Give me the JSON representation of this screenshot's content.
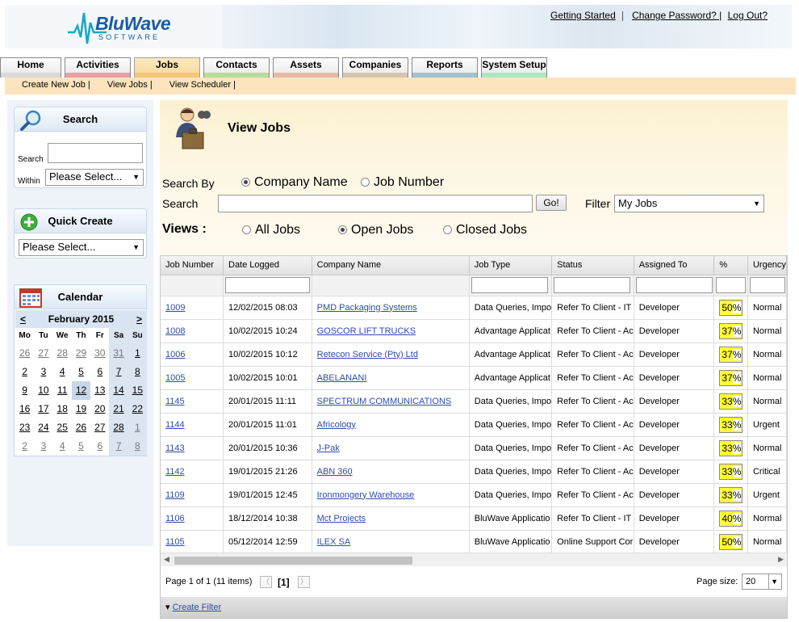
{
  "brand": {
    "logo_main": "BluWave",
    "logo_sub": "SOFTWARE"
  },
  "top_links": {
    "getting_started": "Getting Started",
    "change_password": "Change Password? |",
    "logout": "Log Out?"
  },
  "tabs": [
    {
      "label": "Home",
      "color": "#d9d9d9"
    },
    {
      "label": "Activities",
      "color": "#e8a0a8"
    },
    {
      "label": "Jobs",
      "color": "#f6c77a"
    },
    {
      "label": "Contacts",
      "color": "#b9dc9c"
    },
    {
      "label": "Assets",
      "color": "#e6b9a6"
    },
    {
      "label": "Companies",
      "color": "#d8c5ad"
    },
    {
      "label": "Reports",
      "color": "#9fc2d0"
    },
    {
      "label": "System Setup",
      "color": "#a9e8c2"
    }
  ],
  "subnav": [
    "Create New Job |",
    "View Jobs |",
    "View Scheduler |"
  ],
  "sidebar": {
    "search": {
      "title": "Search",
      "label_search": "Search",
      "label_within": "Within",
      "within_value": "Please Select..."
    },
    "quick_create": {
      "title": "Quick Create",
      "value": "Please Select..."
    },
    "calendar": {
      "title": "Calendar",
      "month": "February 2015",
      "prev": "<",
      "next": ">",
      "dow": [
        "Mo",
        "Tu",
        "We",
        "Th",
        "Fr",
        "Sa",
        "Su"
      ],
      "weeks": [
        [
          "26",
          "27",
          "28",
          "29",
          "30",
          "31",
          "1"
        ],
        [
          "2",
          "3",
          "4",
          "5",
          "6",
          "7",
          "8"
        ],
        [
          "9",
          "10",
          "11",
          "12",
          "13",
          "14",
          "15"
        ],
        [
          "16",
          "17",
          "18",
          "19",
          "20",
          "21",
          "22"
        ],
        [
          "23",
          "24",
          "25",
          "26",
          "27",
          "28",
          "1"
        ],
        [
          "2",
          "3",
          "4",
          "5",
          "6",
          "7",
          "8"
        ]
      ]
    }
  },
  "main": {
    "title": "View Jobs",
    "search_by_label": "Search By",
    "search_by_options": [
      "Company Name",
      "Job Number"
    ],
    "search_label": "Search",
    "go_label": "Go!",
    "filter_label": "Filter",
    "filter_value": "My Jobs",
    "views_label": "Views :",
    "views_options": [
      "All Jobs",
      "Open Jobs",
      "Closed Jobs"
    ]
  },
  "grid": {
    "columns": [
      "Job Number",
      "Date Logged",
      "Company Name",
      "Job Type",
      "Status",
      "Assigned To",
      "%",
      "Urgency"
    ],
    "rows": [
      {
        "job": "1009",
        "date": "12/02/2015 08:03",
        "company": "PMD Packaging Systems",
        "type": "Data Queries, Impo",
        "status": "Refer To Client - IT",
        "assigned": "Developer",
        "pct": "50",
        "urgency": "Normal"
      },
      {
        "job": "1008",
        "date": "10/02/2015 10:24",
        "company": "GOSCOR LIFT TRUCKS",
        "type": "Advantage Applicat",
        "status": "Refer To Client - Ac",
        "assigned": "Developer",
        "pct": "37",
        "urgency": "Normal"
      },
      {
        "job": "1006",
        "date": "10/02/2015 10:12",
        "company": "Retecon Service (Pty) Ltd",
        "type": "Advantage Applicat",
        "status": "Refer To Client - Ac",
        "assigned": "Developer",
        "pct": "37",
        "urgency": "Normal"
      },
      {
        "job": "1005",
        "date": "10/02/2015 10:01",
        "company": "ABELANANI",
        "type": "Advantage Applicat",
        "status": "Refer To Client - Ac",
        "assigned": "Developer",
        "pct": "37",
        "urgency": "Normal"
      },
      {
        "job": "1145",
        "date": "20/01/2015 11:11",
        "company": "SPECTRUM COMMUNICATIONS",
        "type": "Data Queries, Impo",
        "status": "Refer To Client - Ac",
        "assigned": "Developer",
        "pct": "33",
        "urgency": "Normal"
      },
      {
        "job": "1144",
        "date": "20/01/2015 11:01",
        "company": "Africology",
        "type": "Data Queries, Impo",
        "status": "Refer To Client - Ac",
        "assigned": "Developer",
        "pct": "33",
        "urgency": "Urgent"
      },
      {
        "job": "1143",
        "date": "20/01/2015 10:36",
        "company": "J-Pak",
        "type": "Data Queries, Impo",
        "status": "Refer To Client - Ac",
        "assigned": "Developer",
        "pct": "33",
        "urgency": "Normal"
      },
      {
        "job": "1142",
        "date": "19/01/2015 21:26",
        "company": "ABN 360",
        "type": "Data Queries, Impo",
        "status": "Refer To Client - Ac",
        "assigned": "Developer",
        "pct": "33",
        "urgency": "Critical"
      },
      {
        "job": "1109",
        "date": "19/01/2015 12:45",
        "company": "Ironmongery Warehouse",
        "type": "Data Queries, Impo",
        "status": "Refer To Client - Ac",
        "assigned": "Developer",
        "pct": "33",
        "urgency": "Urgent"
      },
      {
        "job": "1106",
        "date": "18/12/2014 10:38",
        "company": "Mct Projects",
        "type": "BluWave Applicatio",
        "status": "Refer To Client - IT",
        "assigned": "Developer",
        "pct": "40",
        "urgency": "Normal"
      },
      {
        "job": "1105",
        "date": "05/12/2014 12:59",
        "company": "ILEX SA",
        "type": "BluWave Applicatio",
        "status": "Online Support Cor",
        "assigned": "Developer",
        "pct": "50",
        "urgency": "Normal"
      }
    ],
    "pct_symbol": "%",
    "pager_text": "Page 1 of 1 (11 items)",
    "current_page": "[1]",
    "page_size_label": "Page size:",
    "page_size_value": "20",
    "create_filter": "Create Filter"
  }
}
